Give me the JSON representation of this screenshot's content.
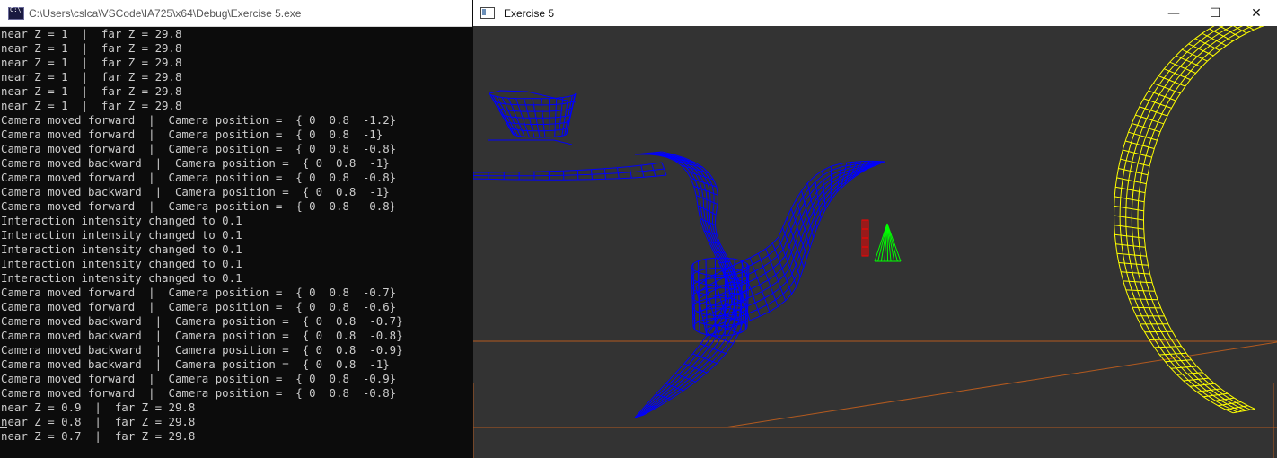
{
  "console": {
    "title": "C:\\Users\\cslca\\VSCode\\IA725\\x64\\Debug\\Exercise 5.exe",
    "lines": [
      "near Z = 1  |  far Z = 29.8",
      "near Z = 1  |  far Z = 29.8",
      "near Z = 1  |  far Z = 29.8",
      "near Z = 1  |  far Z = 29.8",
      "near Z = 1  |  far Z = 29.8",
      "near Z = 1  |  far Z = 29.8",
      "Camera moved forward  |  Camera position =  { 0  0.8  -1.2}",
      "Camera moved forward  |  Camera position =  { 0  0.8  -1}",
      "Camera moved forward  |  Camera position =  { 0  0.8  -0.8}",
      "Camera moved backward  |  Camera position =  { 0  0.8  -1}",
      "Camera moved forward  |  Camera position =  { 0  0.8  -0.8}",
      "Camera moved backward  |  Camera position =  { 0  0.8  -1}",
      "Camera moved forward  |  Camera position =  { 0  0.8  -0.8}",
      "Interaction intensity changed to 0.1",
      "Interaction intensity changed to 0.1",
      "Interaction intensity changed to 0.1",
      "Interaction intensity changed to 0.1",
      "Interaction intensity changed to 0.1",
      "Camera moved forward  |  Camera position =  { 0  0.8  -0.7}",
      "Camera moved forward  |  Camera position =  { 0  0.8  -0.6}",
      "Camera moved backward  |  Camera position =  { 0  0.8  -0.7}",
      "Camera moved backward  |  Camera position =  { 0  0.8  -0.8}",
      "Camera moved backward  |  Camera position =  { 0  0.8  -0.9}",
      "Camera moved backward  |  Camera position =  { 0  0.8  -1}",
      "Camera moved forward  |  Camera position =  { 0  0.8  -0.9}",
      "Camera moved forward  |  Camera position =  { 0  0.8  -0.8}",
      "near Z = 0.9  |  far Z = 29.8",
      "near Z = 0.8  |  far Z = 29.8",
      "near Z = 0.7  |  far Z = 29.8"
    ]
  },
  "graphics_window": {
    "title": "Exercise 5",
    "controls": {
      "minimize": "—",
      "maximize": "☐",
      "close": "✕"
    },
    "icon": "window-app-icon"
  },
  "scene": {
    "background": "#333333",
    "objects": [
      {
        "name": "blue-wireframe-surface",
        "color": "#0000ff"
      },
      {
        "name": "red-wireframe-cylinder",
        "color": "#ff0000"
      },
      {
        "name": "green-wireframe-cone",
        "color": "#00ff00"
      },
      {
        "name": "yellow-wireframe-torus",
        "color": "#ffff00"
      },
      {
        "name": "floor-lines",
        "color": "#b35a1f"
      }
    ]
  }
}
